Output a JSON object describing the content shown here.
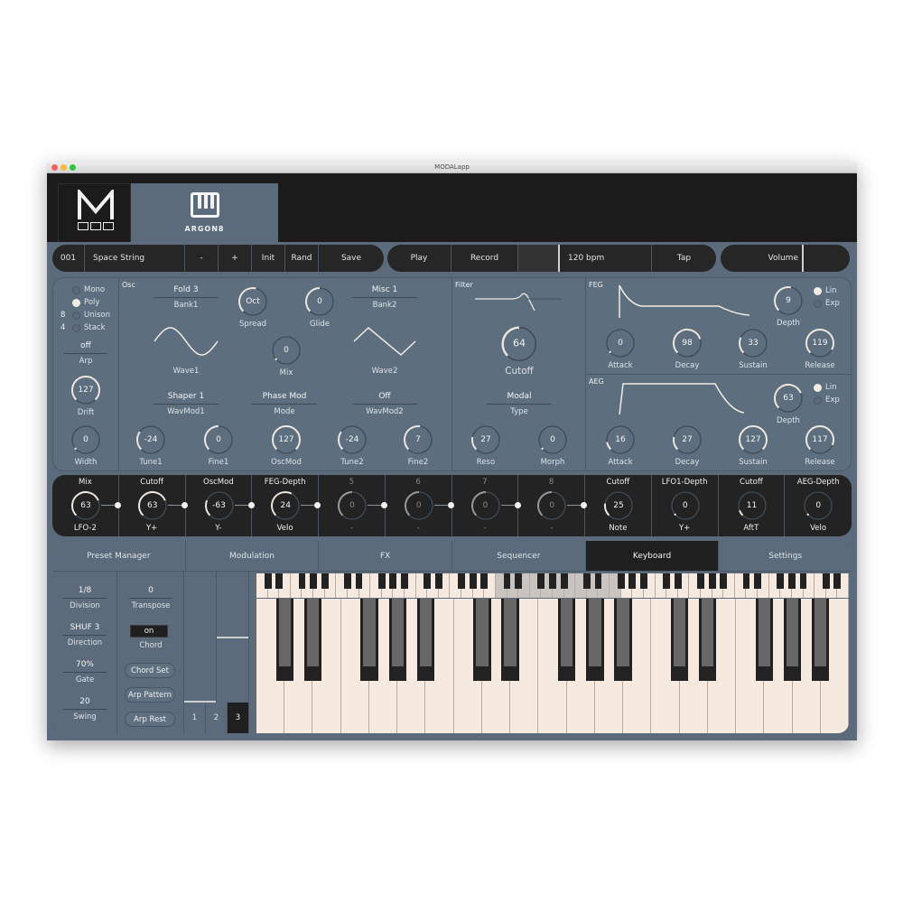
{
  "window": {
    "title": "MODALapp"
  },
  "header": {
    "product_name": "ARGON8",
    "logo": "modal-m-logo"
  },
  "toolbar": {
    "preset_number": "001",
    "preset_name": "Space String",
    "prev_label": "-",
    "next_label": "+",
    "init_label": "Init",
    "rand_label": "Rand",
    "save_label": "Save",
    "play_label": "Play",
    "record_label": "Record",
    "tempo": "120 bpm",
    "tap_label": "Tap",
    "volume_label": "Volume"
  },
  "voice": {
    "modes": [
      {
        "label": "Mono",
        "selected": false,
        "count": ""
      },
      {
        "label": "Poly",
        "selected": true,
        "count": ""
      },
      {
        "label": "Unison",
        "selected": false,
        "count": "8"
      },
      {
        "label": "Stack",
        "selected": false,
        "count": "4"
      }
    ],
    "arp": {
      "value": "off",
      "label": "Arp"
    },
    "drift": {
      "value": "127",
      "label": "Drift",
      "level": 1.0
    },
    "width": {
      "value": "0",
      "label": "Width",
      "level": 0.0
    }
  },
  "osc": {
    "label": "Osc",
    "bank1": {
      "value": "Fold 3",
      "label": "Bank1"
    },
    "bank2": {
      "value": "Misc 1",
      "label": "Bank2"
    },
    "wave1_label": "Wave1",
    "wave2_label": "Wave2",
    "spread": {
      "value": "Oct",
      "label": "Spread",
      "level": 0.55
    },
    "glide": {
      "value": "0",
      "label": "Glide",
      "level": 0.5
    },
    "mix": {
      "value": "0",
      "label": "Mix",
      "level": 0.0
    },
    "wavmod1": {
      "value": "Shaper 1",
      "label": "WavMod1"
    },
    "mode": {
      "value": "Phase Mod",
      "label": "Mode"
    },
    "wavmod2": {
      "value": "Off",
      "label": "WavMod2"
    },
    "tune1": {
      "value": "-24",
      "label": "Tune1",
      "level": 0.3
    },
    "fine1": {
      "value": "0",
      "label": "Fine1",
      "level": 0.5
    },
    "oscmod": {
      "value": "127",
      "label": "OscMod",
      "level": 1.0
    },
    "tune2": {
      "value": "-24",
      "label": "Tune2",
      "level": 0.3
    },
    "fine2": {
      "value": "7",
      "label": "Fine2",
      "level": 0.53
    }
  },
  "filter": {
    "label": "Filter",
    "cutoff": {
      "value": "64",
      "label": "Cutoff",
      "level": 0.5
    },
    "type": {
      "value": "Modal",
      "label": "Type"
    },
    "reso": {
      "value": "27",
      "label": "Reso",
      "level": 0.21
    },
    "morph": {
      "value": "0",
      "label": "Morph",
      "level": 0.0
    }
  },
  "feg": {
    "label": "FEG",
    "depth": {
      "value": "9",
      "label": "Depth",
      "level": 0.54
    },
    "curve": [
      {
        "label": "Lin",
        "selected": true
      },
      {
        "label": "Exp",
        "selected": false
      }
    ],
    "attack": {
      "value": "0",
      "label": "Attack",
      "level": 0.0
    },
    "decay": {
      "value": "98",
      "label": "Decay",
      "level": 0.77
    },
    "sustain": {
      "value": "33",
      "label": "Sustain",
      "level": 0.26
    },
    "release": {
      "value": "119",
      "label": "Release",
      "level": 0.94
    }
  },
  "aeg": {
    "label": "AEG",
    "depth": {
      "value": "63",
      "label": "Depth",
      "level": 0.75
    },
    "curve": [
      {
        "label": "Lin",
        "selected": true
      },
      {
        "label": "Exp",
        "selected": false
      }
    ],
    "attack": {
      "value": "16",
      "label": "Attack",
      "level": 0.13
    },
    "decay": {
      "value": "27",
      "label": "Decay",
      "level": 0.21
    },
    "sustain": {
      "value": "127",
      "label": "Sustain",
      "level": 1.0
    },
    "release": {
      "value": "117",
      "label": "Release",
      "level": 0.92
    }
  },
  "mod_slots": [
    {
      "target": "Mix",
      "value": "63",
      "source": "LFO-2",
      "level": 0.75,
      "active": true,
      "linked": true
    },
    {
      "target": "Cutoff",
      "value": "63",
      "source": "Y+",
      "level": 0.75,
      "active": true,
      "linked": true
    },
    {
      "target": "OscMod",
      "value": "-63",
      "source": "Y-",
      "level": 0.25,
      "active": true,
      "linked": true
    },
    {
      "target": "FEG-Depth",
      "value": "24",
      "source": "Velo",
      "level": 0.6,
      "active": true,
      "linked": true
    },
    {
      "target": "5",
      "value": "0",
      "source": "-",
      "level": 0.5,
      "active": false,
      "linked": true
    },
    {
      "target": "6",
      "value": "0",
      "source": "-",
      "level": 0.5,
      "active": false,
      "linked": true
    },
    {
      "target": "7",
      "value": "0",
      "source": "-",
      "level": 0.5,
      "active": false,
      "linked": true
    },
    {
      "target": "8",
      "value": "0",
      "source": "-",
      "level": 0.5,
      "active": false,
      "linked": true
    },
    {
      "target": "Cutoff",
      "value": "25",
      "source": "Note",
      "level": 0.2,
      "active": true,
      "linked": false
    },
    {
      "target": "LFO1-Depth",
      "value": "0",
      "source": "Y+",
      "level": 0.0,
      "active": true,
      "linked": false
    },
    {
      "target": "Cutoff",
      "value": "11",
      "source": "AftT",
      "level": 0.09,
      "active": true,
      "linked": false
    },
    {
      "target": "AEG-Depth",
      "value": "0",
      "source": "Velo",
      "level": 0.0,
      "active": true,
      "linked": false
    }
  ],
  "tabs": [
    {
      "label": "Preset Manager",
      "active": false
    },
    {
      "label": "Modulation",
      "active": false
    },
    {
      "label": "FX",
      "active": false
    },
    {
      "label": "Sequencer",
      "active": false
    },
    {
      "label": "Keyboard",
      "active": true
    },
    {
      "label": "Settings",
      "active": false
    }
  ],
  "arp_panel": {
    "division": {
      "value": "1/8",
      "label": "Division"
    },
    "direction": {
      "value": "SHUF 3",
      "label": "Direction"
    },
    "gate": {
      "value": "70%",
      "label": "Gate"
    },
    "swing": {
      "value": "20",
      "label": "Swing"
    }
  },
  "chord_panel": {
    "transpose": {
      "value": "0",
      "label": "Transpose"
    },
    "chord": {
      "value": "on",
      "label": "Chord"
    },
    "chord_set_label": "Chord Set",
    "arp_pattern_label": "Arp Pattern",
    "arp_rest_label": "Arp Rest"
  },
  "wheels": {
    "pitch_level": 0.5,
    "mod_level": 0.0
  },
  "octave_buttons": [
    {
      "label": "1",
      "active": false
    },
    {
      "label": "2",
      "active": false
    },
    {
      "label": "3",
      "active": true
    }
  ],
  "keyboard": {
    "white_keys": 21,
    "mini_white_keys": 52,
    "visible_range_start": 0.4,
    "visible_range_end": 0.6
  }
}
